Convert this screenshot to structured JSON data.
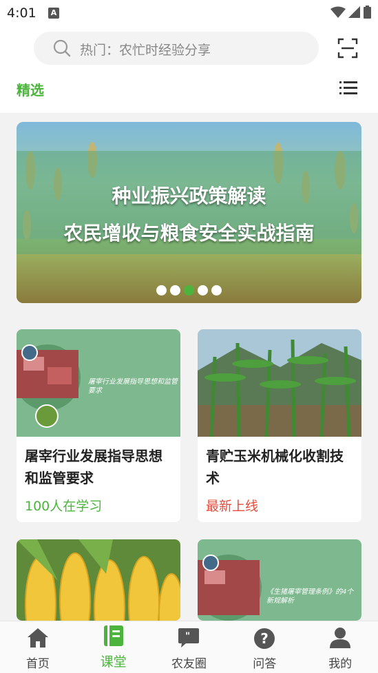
{
  "status_bar": {
    "time": "4:01",
    "notification_icon": "A"
  },
  "search": {
    "placeholder": "热门：农忙时经验分享"
  },
  "section": {
    "featured_label": "精选"
  },
  "banner": {
    "line1": "种业振兴政策解读",
    "line2": "农民增收与粮食安全实战指南",
    "dots": 5,
    "active_dot": 3
  },
  "cards": [
    {
      "title": "屠宰行业发展指导思想和监管要求",
      "meta": "100人在学习",
      "meta_color": "#4cb43c",
      "image_text": "屠宰行业发展指导思想和监管要求"
    },
    {
      "title": "青贮玉米机械化收割技术",
      "meta": "最新上线",
      "meta_color": "#e74c3c"
    },
    {
      "title": "",
      "meta": ""
    },
    {
      "title": "",
      "meta": "",
      "image_text": "《生猪屠宰管理条例》的4个新规解析"
    }
  ],
  "nav": {
    "items": [
      {
        "label": "首页",
        "icon": "home-icon"
      },
      {
        "label": "课堂",
        "icon": "book-icon",
        "active": true
      },
      {
        "label": "农友圈",
        "icon": "chat-icon"
      },
      {
        "label": "问答",
        "icon": "question-icon"
      },
      {
        "label": "我的",
        "icon": "user-icon"
      }
    ]
  },
  "colors": {
    "accent": "#4cb43c",
    "alert": "#e74c3c"
  }
}
